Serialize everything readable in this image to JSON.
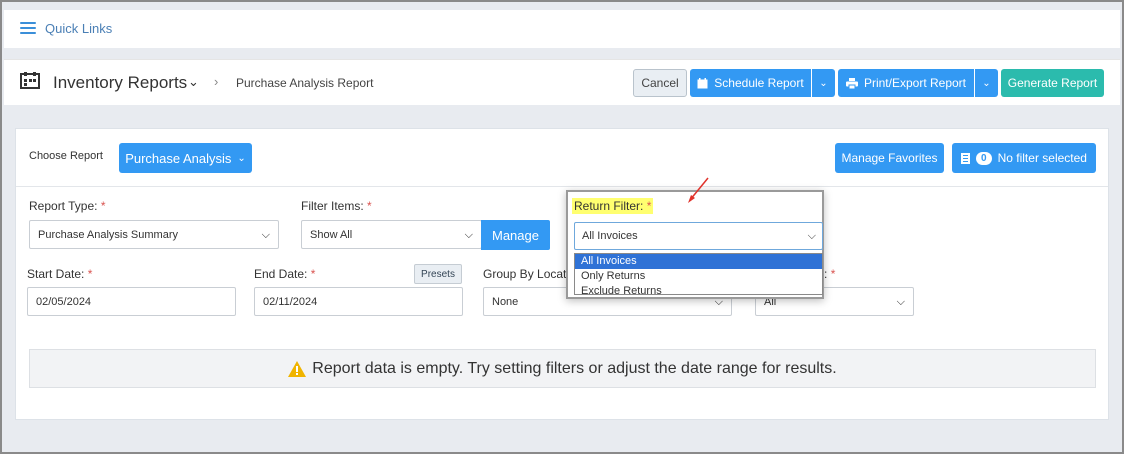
{
  "quick_links": {
    "label": "Quick Links"
  },
  "header": {
    "title": "Inventory Reports",
    "breadcrumb": "Purchase Analysis Report",
    "cancel_label": "Cancel",
    "schedule_label": "Schedule Report",
    "print_label": "Print/Export Report",
    "generate_label": "Generate Report"
  },
  "report": {
    "choose_label": "Choose Report",
    "choose_value": "Purchase Analysis",
    "manage_favorites": "Manage Favorites",
    "filter_count": "0",
    "filter_status": "No filter selected"
  },
  "fields": {
    "report_type_label": "Report Type:",
    "report_type_value": "Purchase Analysis Summary",
    "filter_items_label": "Filter Items:",
    "filter_items_value": "Show All",
    "manage_label": "Manage",
    "start_date_label": "Start Date:",
    "start_date_value": "02/05/2024",
    "end_date_label": "End Date:",
    "end_date_value": "02/11/2024",
    "presets_label": "Presets",
    "group_by_label": "Group By Locatio",
    "group_by_value": "None",
    "hidden_label_suffix": ":",
    "hidden_value": "All",
    "required_mark": "*"
  },
  "return_filter": {
    "label": "Return Filter:",
    "value": "All Invoices",
    "options": [
      "All Invoices",
      "Only Returns",
      "Exclude Returns"
    ]
  },
  "notice": {
    "text": "Report data is empty. Try setting filters or adjust the date range for results."
  },
  "colors": {
    "primary": "#3399f3",
    "teal": "#2bbbad",
    "highlight": "#ffff70",
    "selected_option": "#2f72d6"
  }
}
